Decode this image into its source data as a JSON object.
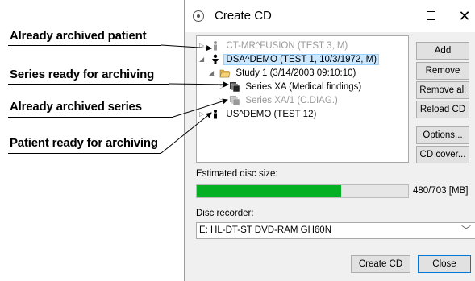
{
  "annotations": [
    "Already archived patient",
    "Series ready for archiving",
    "Already archived series",
    "Patient ready for archiving"
  ],
  "window": {
    "title": "Create CD",
    "maximize_icon": "maximize-icon",
    "close_glyph": "✕"
  },
  "tree": [
    {
      "expander": "▷",
      "icon": "patient-archived-icon",
      "label": "CT-MR^FUSION (TEST 3, M)",
      "gray": true
    },
    {
      "expander": "◢",
      "icon": "patient-icon",
      "label": "DSA^DEMO (TEST 1, 10/3/1972, M)",
      "selected": true
    },
    {
      "expander": "◢",
      "icon": "folder-open-icon",
      "label": "Study 1 (3/14/2003 09:10:10)"
    },
    {
      "expander": "▷",
      "icon": "series-icon",
      "label": "Series XA (Medical findings)"
    },
    {
      "expander": "▷",
      "icon": "series-archived-icon",
      "label": "Series XA/1 (C.DIAG.)",
      "gray": true
    },
    {
      "expander": "▷",
      "icon": "patient-icon",
      "label": "US^DEMO (TEST 12)"
    }
  ],
  "buttons": {
    "add": "Add",
    "remove": "Remove",
    "remove_all": "Remove all",
    "reload_cd": "Reload CD",
    "options": "Options...",
    "cd_cover": "CD cover...",
    "create_cd": "Create CD",
    "close": "Close"
  },
  "disc": {
    "label": "Estimated disc size:",
    "used": 480,
    "capacity": 703,
    "text": "480/703 [MB]",
    "fill_color": "#06b025"
  },
  "recorder": {
    "label": "Disc recorder:",
    "value": "E: HL-DT-ST DVD-RAM GH60N"
  }
}
